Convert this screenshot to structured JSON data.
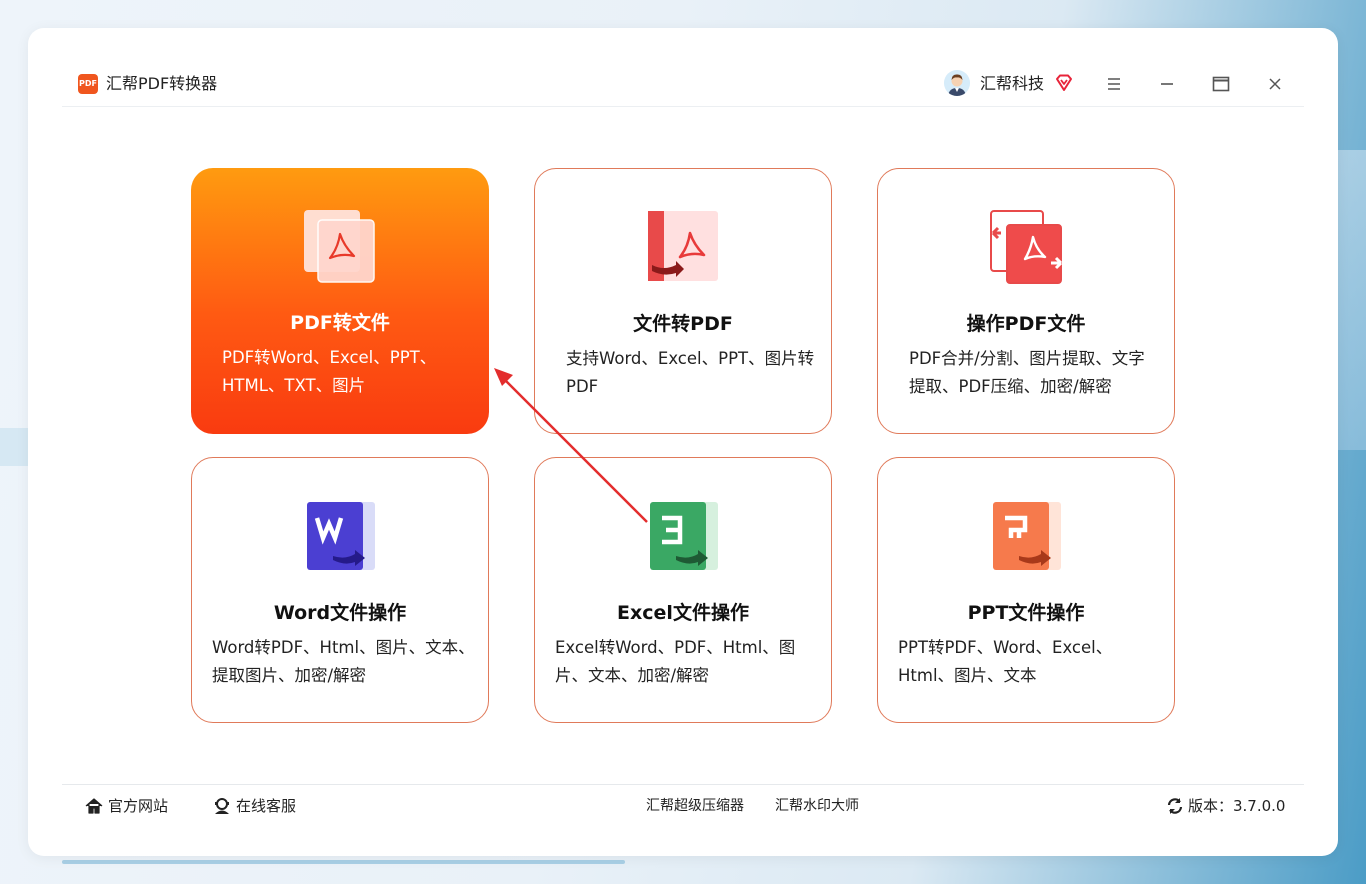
{
  "app": {
    "title": "汇帮PDF转换器",
    "logo_text": "PDF"
  },
  "user": {
    "name": "汇帮科技"
  },
  "cards": [
    {
      "title": "PDF转文件",
      "desc": "PDF转Word、Excel、PPT、HTML、TXT、图片"
    },
    {
      "title": "文件转PDF",
      "desc": "支持Word、Excel、PPT、图片转PDF"
    },
    {
      "title": "操作PDF文件",
      "desc": "PDF合并/分割、图片提取、文字提取、PDF压缩、加密/解密"
    },
    {
      "title": "Word文件操作",
      "desc": "Word转PDF、Html、图片、文本、提取图片、加密/解密"
    },
    {
      "title": "Excel文件操作",
      "desc": "Excel转Word、PDF、Html、图片、文本、加密/解密"
    },
    {
      "title": "PPT文件操作",
      "desc": "PPT转PDF、Word、Excel、Html、图片、文本"
    }
  ],
  "footer": {
    "website": "官方网站",
    "support": "在线客服",
    "compressor": "汇帮超级压缩器",
    "watermark": "汇帮水印大师",
    "version": "版本：3.7.0.0"
  },
  "colors": {
    "accent": "#ff5a12",
    "card_border": "#e07a5a"
  }
}
